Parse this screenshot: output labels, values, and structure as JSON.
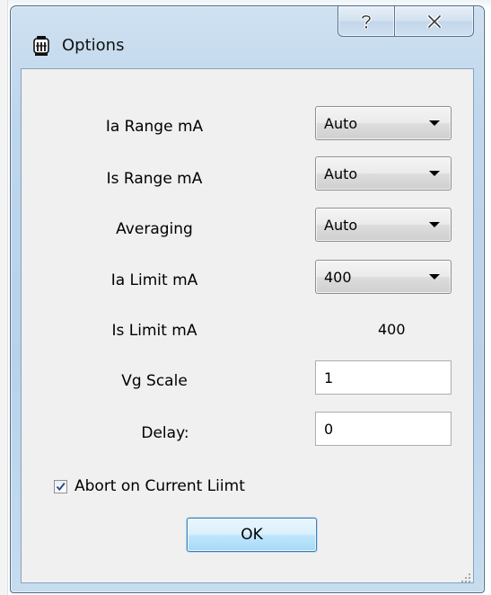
{
  "window": {
    "title": "Options",
    "app_icon": "tube-icon",
    "help_icon": "question-mark-icon",
    "close_icon": "close-x-icon"
  },
  "form": {
    "ia_range": {
      "label": "Ia Range mA",
      "value": "Auto"
    },
    "is_range": {
      "label": "Is Range mA",
      "value": "Auto"
    },
    "averaging": {
      "label": "Averaging",
      "value": "Auto"
    },
    "ia_limit": {
      "label": "Ia Limit mA",
      "value": "400"
    },
    "is_limit": {
      "label": "Is Limit mA",
      "value": "400"
    },
    "vg_scale": {
      "label": "Vg Scale",
      "value": "1"
    },
    "delay": {
      "label": "Delay:",
      "value": "0"
    },
    "abort_on_current_limit": {
      "label": "Abort on Current Liimt",
      "checked": true
    }
  },
  "buttons": {
    "ok_label": "OK"
  },
  "colors": {
    "frame": "#b9d2ea",
    "client_bg": "#f0f0f0",
    "ok_button": "#bee6fd"
  }
}
